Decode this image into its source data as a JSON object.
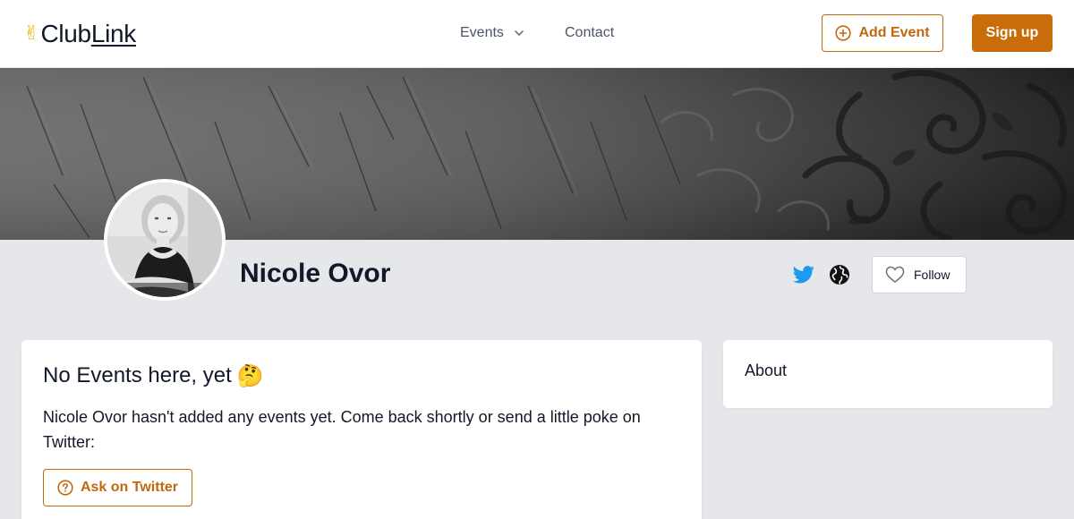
{
  "brand": {
    "name_part1": "Club",
    "name_part2": "Link",
    "hand_glyph": "✌",
    "icon": "victory-hand-icon"
  },
  "nav": {
    "events_label": "Events",
    "contact_label": "Contact"
  },
  "header": {
    "add_event_label": "Add Event",
    "signup_label": "Sign up"
  },
  "profile": {
    "name": "Nicole Ovor",
    "follow_label": "Follow"
  },
  "events_card": {
    "title": "No Events here, yet",
    "title_emoji": "🤔",
    "message": "Nicole Ovor hasn't added any events yet. Come back shortly or send a little poke on Twitter:",
    "ask_label": "Ask on Twitter"
  },
  "about_card": {
    "title": "About"
  },
  "colors": {
    "accent": "#c96c0a",
    "accent_outline": "#c2680c",
    "twitter": "#1d9bf0",
    "page_bg": "#e5e7eb"
  }
}
